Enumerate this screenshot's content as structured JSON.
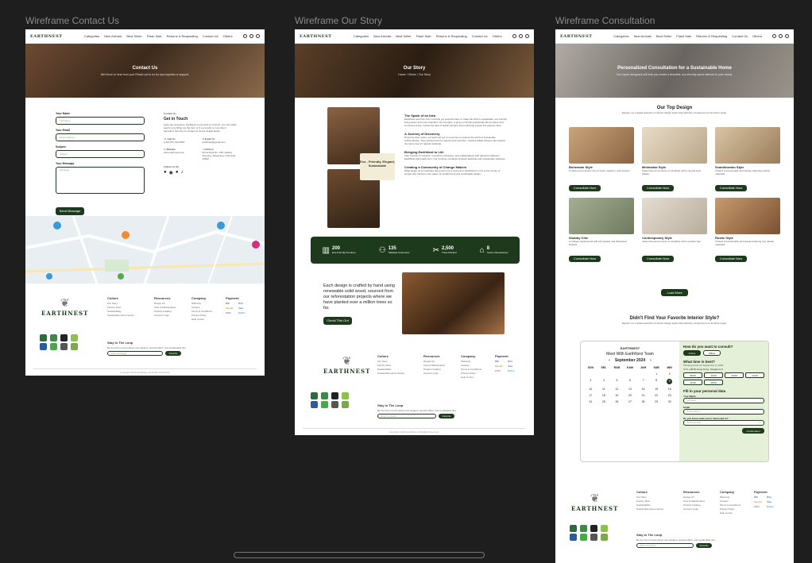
{
  "frames": {
    "contact_title": "Wireframe Contact Us",
    "story_title": "Wireframe Our Story",
    "consult_title": "Wireframe Consultation"
  },
  "nav": {
    "logo": "EARTHNEST",
    "links": [
      "Categories",
      "New Arrivals",
      "Best Seller",
      "Flash Sale",
      "Returns & Requesting",
      "Contact Us",
      "Others"
    ]
  },
  "contact": {
    "hero_title": "Contact Us",
    "hero_sub": "We'd love to hear from you! Reach out to us for any inquiries or support.",
    "form": {
      "name_label": "Your Name",
      "name_ph": "Full Name",
      "email_label": "Your Email",
      "email_ph": "Email address",
      "subject_label": "Subject",
      "subject_ph": "Subject",
      "message_label": "Your Message",
      "message_ph": "Message",
      "send": "Send Message"
    },
    "info": {
      "heading_small": "Contact Us",
      "heading": "Get in Touch",
      "body": "Have any questions, feedback or just want to connect, you can easily reach us by filling out the form or if you prefer a more direct approach, feel free to contact us via the details below.",
      "call_label": "Call Us",
      "call_value": "(+62) 877-123-4567",
      "email_label": "Email Us",
      "email_value": "earthnest@gmail.com",
      "web_label": "Website",
      "web_value": "www.earthnest.com",
      "addr_label": "Address",
      "addr_value": "Prima Park No. 108, Gading Serpong, Tangerang, Indonesia 15810",
      "follow": "Follow Us On"
    }
  },
  "story": {
    "hero_title": "Our Story",
    "hero_crumb": "Home / Others / Our Story",
    "badge": "Eco - Friendly, Elegant, Sustainable",
    "sections": [
      {
        "title": "The Spark of an Idea",
        "body": "EarthNest was born from a simple yet powerful idea: to make the shift to sustainable, eco-friendly living easier and more beautiful. Our founders, a group of friends passionate about nature and conscious living, noticed the lack of stylish furniture that could help people live greener lives."
      },
      {
        "title": "A Journey of Discovery",
        "body": "Driven by their vision, our team set out on a journey to explore the world of sustainable craftsmanship. They traveled across regions and countries, meeting skilled artisans who shared the same love for natural materials."
      },
      {
        "title": "Bringing EarthNest to Life",
        "body": "After months of research, countless prototypes, and collaborations with talented craftsmen, EarthNest was finally born. Our furniture combines timeless aesthetic with sustainable practices."
      },
      {
        "title": "Creating a Community of Change Makers",
        "body": "What began as a small idea has grown into a movement. EarthNest is now a community of people who believe in the power of mindful living and sustainable design."
      }
    ],
    "stats": [
      {
        "value": "200",
        "label": "Eco-Friendly Furniture"
      },
      {
        "value": "135",
        "label": "Satisfied Customers"
      },
      {
        "value": "2,500",
        "label": "Trees Planted"
      },
      {
        "value": "8",
        "label": "Years of Experience"
      }
    ],
    "promo": "Each design is crafted by hand using renewable solid wood, sourced from our reforestation projects where we have planted over a million trees so far.",
    "promo_btn": "Check This Out"
  },
  "consult": {
    "hero_title": "Personalized Consultation for a Sustainable Home",
    "hero_sub": "Our expert designers will help you create a beautiful, eco-friendly space tailored to your needs.",
    "top_title": "Our Top Design",
    "top_sub": "Explore our curated selection of interior design styles that perfectly complement our furniture range.",
    "styles": [
      {
        "name": "Bohemian Style",
        "desc": "A vibrant and eclectic mix of colors, patterns, and textures.",
        "btn": "Consultate Now"
      },
      {
        "name": "Minimalist Style",
        "desc": "Clean lines and a focus on simplicity with a neutral color palette.",
        "btn": "Consultate Now"
      },
      {
        "name": "Scandinavian Style",
        "desc": "A blend of functionality and beauty, featuring natural materials.",
        "btn": "Consultate Now"
      },
      {
        "name": "Shabby Chic",
        "desc": "A vintage-inspired look with soft pastels and distressed finishes.",
        "btn": "Consultate Now"
      },
      {
        "name": "Contemporary Style",
        "desc": "Clean lines and a focus on simplicity with a modern feel.",
        "btn": "Consultate Now"
      },
      {
        "name": "Rustic Style",
        "desc": "A blend of functionality and beauty featuring raw natural materials.",
        "btn": "Consultate Now"
      }
    ],
    "load_more": "Load More",
    "didnt_find": "Didn't Find Your Favorite Interior Style?",
    "didnt_sub": "Explore our curated selection of interior design styles that perfectly complement our furniture range.",
    "booking": {
      "meet": "Meet With EarthNest Team",
      "month": "September 2024",
      "days": [
        "SUN",
        "SEL",
        "RAB",
        "KAM",
        "JUM",
        "SAB",
        "MIN"
      ],
      "dates": [
        "",
        "",
        "",
        "",
        "",
        "1",
        "2",
        "3",
        "4",
        "5",
        "6",
        "7",
        "8",
        "9",
        "10",
        "11",
        "12",
        "13",
        "14",
        "15",
        "16",
        "17",
        "18",
        "19",
        "20",
        "21",
        "22",
        "23",
        "24",
        "25",
        "26",
        "27",
        "28",
        "29",
        "30"
      ],
      "selected_date": "9",
      "how": "How do you want to consult?",
      "online": "Online",
      "offline": "Offline",
      "time_q": "What time is best?",
      "time_sub": "Showing times for September 9, 2024",
      "timezone": "UTC +08:00 Hong Kong, Singapore",
      "times": [
        "09:00",
        "10:00",
        "13:00",
        "14:00",
        "15:00",
        "16:00"
      ],
      "fill": "Fill in your personal data",
      "name_label": "Your Name",
      "name_ph": "Full Name",
      "email_label": "Email",
      "email_ph": "Email address",
      "style_label": "Do you know what you're interested in?",
      "style_ph": "Bohemian Style",
      "confirm": "Confirmation"
    }
  },
  "footer": {
    "logo": "EARTHNEST",
    "logo_sub": "Furniture",
    "culture_h": "Culture",
    "culture": [
      "Our Story",
      "Factory Root",
      "Sustainability",
      "Sustainable Home Series"
    ],
    "resources_h": "Resources",
    "resources": [
      "Design Art",
      "Care & Maintenance",
      "Product Catalog",
      "Account Login"
    ],
    "company_h": "Company",
    "company": [
      "Warranty",
      "Careers",
      "Terms & Conditions",
      "Privacy Policy",
      "Help Center"
    ],
    "payment_h": "Payment",
    "payments": [
      "BRI",
      "BCA",
      "Mandiri",
      "Visa",
      "OVO",
      "DANA",
      "GoPay",
      "OVO"
    ],
    "newsletter_h": "Stay In The Loop",
    "newsletter_sub": "Be the first to know about new designs, special offers, and sustainable tips.",
    "email_ph": "Enter Your Email",
    "subscribe": "Subscribe",
    "copyright": "Copyright 2024 EarthNest. All Rights Reserved."
  }
}
